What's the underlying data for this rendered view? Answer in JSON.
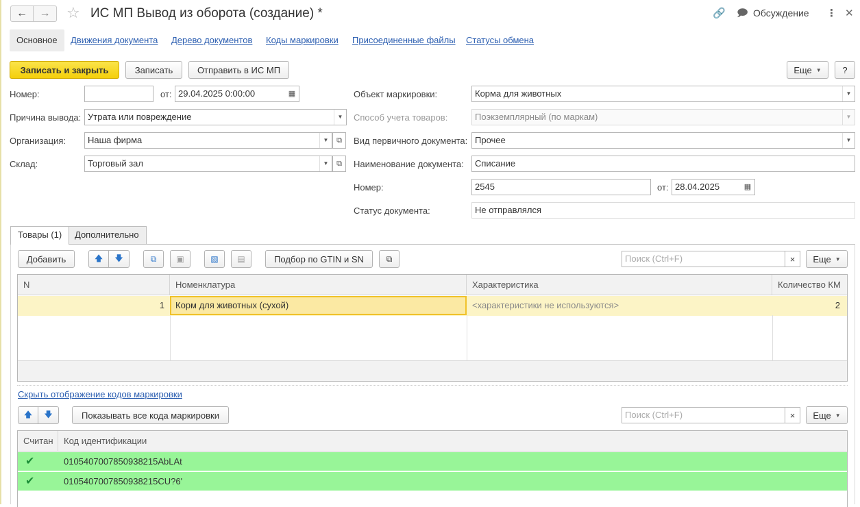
{
  "window": {
    "title": "ИС МП Вывод из оборота (создание) *",
    "discuss_label": "Обсуждение"
  },
  "tabs": [
    {
      "label": "Основное"
    },
    {
      "label": "Движения документа"
    },
    {
      "label": "Дерево документов"
    },
    {
      "label": "Коды маркировки"
    },
    {
      "label": "Присоединенные файлы"
    },
    {
      "label": "Статусы обмена"
    }
  ],
  "toolbar": {
    "save_close": "Записать и закрыть",
    "save": "Записать",
    "send": "Отправить в ИС МП",
    "more": "Еще",
    "help": "?"
  },
  "form": {
    "number_label": "Номер:",
    "number_value": "",
    "date_label": "от:",
    "date_value": "29.04.2025  0:00:00",
    "reason_label": "Причина вывода:",
    "reason_value": "Утрата или повреждение",
    "org_label": "Организация:",
    "org_value": "Наша фирма",
    "warehouse_label": "Склад:",
    "warehouse_value": "Торговый зал",
    "object_label": "Объект маркировки:",
    "object_value": "Корма для животных",
    "method_label": "Способ учета товаров:",
    "method_value": "Поэкземплярный (по маркам)",
    "primary_type_label": "Вид первичного документа:",
    "primary_type_value": "Прочее",
    "doc_name_label": "Наименование документа:",
    "doc_name_value": "Списание",
    "doc_number_label": "Номер:",
    "doc_number_value": "2545",
    "doc_date_label": "от:",
    "doc_date_value": "28.04.2025",
    "status_label": "Статус документа:",
    "status_value": "Не отправлялся"
  },
  "inner_tabs": [
    {
      "label": "Товары (1)"
    },
    {
      "label": "Дополнительно"
    }
  ],
  "goods_toolbar": {
    "add": "Добавить",
    "pick_gtin": "Подбор по GTIN и SN",
    "search_placeholder": "Поиск (Ctrl+F)",
    "more": "Еще"
  },
  "goods_table": {
    "headers": [
      "N",
      "Номенклатура",
      "Характеристика",
      "Количество КМ"
    ],
    "rows": [
      {
        "n": "1",
        "nomenclature": "Корм для животных (сухой)",
        "characteristic": "<характеристики не используются>",
        "qty": "2"
      }
    ]
  },
  "hide_codes_link": "Скрыть отображение кодов маркировки",
  "codes_toolbar": {
    "show_all": "Показывать все кода маркировки",
    "search_placeholder": "Поиск (Ctrl+F)",
    "more": "Еще"
  },
  "codes_table": {
    "headers": [
      "Считан",
      "Код идентификации"
    ],
    "rows": [
      {
        "scanned": "✔",
        "code": "0105407007850938215AbLAt"
      },
      {
        "scanned": "✔",
        "code": "0105407007850938215CU?6'"
      }
    ]
  },
  "colors": {
    "primary_button": "#f4cf0a",
    "link": "#2a5db0",
    "selected_row": "#fcf4c6",
    "scanned_row": "#98f598"
  }
}
